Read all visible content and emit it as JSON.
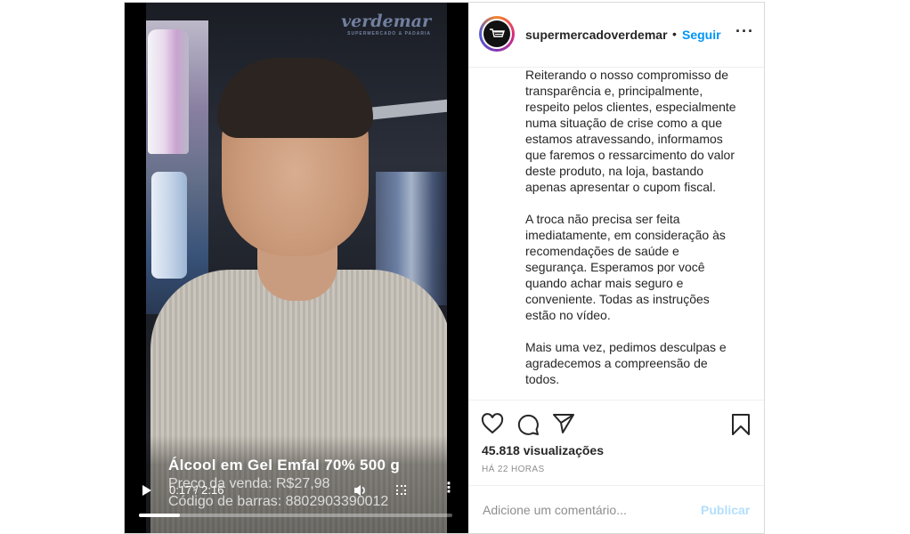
{
  "video": {
    "watermark_brand": "verdemar",
    "watermark_sub": "SUPERMERCADO & PADARIA",
    "product_title": "Álcool em Gel Emfal 70% 500 g",
    "product_price": "Preço da venda: R$27,98",
    "product_barcode": "Código de barras: 8802903390012",
    "time_display": "0:17 / 2:16",
    "progress": 0.13
  },
  "header": {
    "username": "supermercadoverdemar",
    "separator": "•",
    "follow_label": "Seguir",
    "more_label": "···"
  },
  "caption": {
    "paragraphs": [
      "Reiterando o nosso compromisso de transparência e, principalmente, respeito pelos clientes, especialmente numa situação de crise como a que estamos atravessando, informamos que faremos o ressarcimento do valor deste produto, na loja, bastando apenas apresentar o cupom fiscal.",
      "A troca não precisa ser feita imediatamente, em consideração às recomendações de saúde e segurança. Esperamos por você quando achar mais seguro e conveniente. Todas as instruções estão no vídeo.",
      "Mais uma vez, pedimos desculpas e agradecemos a compreensão de todos."
    ]
  },
  "stats": {
    "views": "45.818 visualizações",
    "posted": "HÁ 22 HORAS"
  },
  "comment": {
    "placeholder": "Adicione um comentário...",
    "publish_label": "Publicar"
  },
  "colors": {
    "link": "#0095f6",
    "publish_disabled": "#b2dffc",
    "muted": "#8e8e8e"
  }
}
